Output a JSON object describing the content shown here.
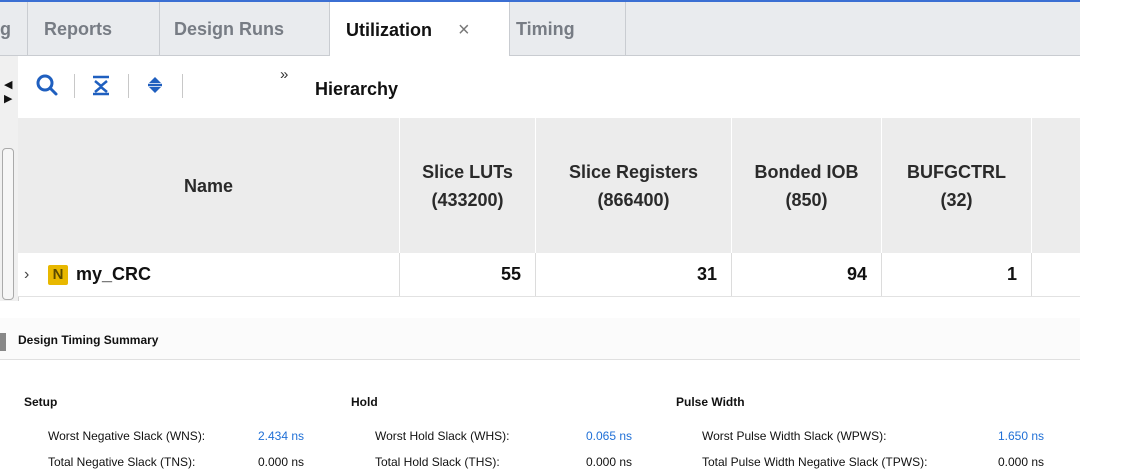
{
  "tabs": [
    {
      "label": "g"
    },
    {
      "label": "Reports"
    },
    {
      "label": "Design Runs"
    },
    {
      "label": "Utilization",
      "close": "×"
    },
    {
      "label": "Timing"
    }
  ],
  "toolbar": {
    "title": "Hierarchy",
    "chevron": "»",
    "icons": [
      "search-icon",
      "collapse-all-icon",
      "expand-all-icon"
    ]
  },
  "utilization_table": {
    "headers": [
      {
        "line1": "Name",
        "line2": ""
      },
      {
        "line1": "Slice LUTs",
        "line2": "(433200)"
      },
      {
        "line1": "Slice Registers",
        "line2": "(866400)"
      },
      {
        "line1": "Bonded IOB",
        "line2": "(850)"
      },
      {
        "line1": "BUFGCTRL",
        "line2": "(32)"
      }
    ],
    "rows": [
      {
        "expander": "›",
        "name": "my_CRC",
        "icon": "N",
        "values": [
          "55",
          "31",
          "94",
          "1"
        ]
      }
    ]
  },
  "timing": {
    "title": "Design Timing Summary",
    "setup": {
      "title": "Setup",
      "rows": [
        {
          "label": "Worst Negative Slack (WNS):",
          "value": "2.434 ns"
        },
        {
          "label": "Total Negative Slack (TNS):",
          "value": "0.000 ns"
        }
      ]
    },
    "hold": {
      "title": "Hold",
      "rows": [
        {
          "label": "Worst Hold Slack (WHS):",
          "value": "0.065 ns"
        },
        {
          "label": "Total Hold Slack (THS):",
          "value": "0.000 ns"
        }
      ]
    },
    "pulse": {
      "title": "Pulse Width",
      "rows": [
        {
          "label": "Worst Pulse Width Slack (WPWS):",
          "value": "1.650 ns"
        },
        {
          "label": "Total Pulse Width Negative Slack (TPWS):",
          "value": "0.000 ns"
        }
      ]
    },
    "colors": {
      "link": "#1f6fd6"
    }
  },
  "colors": {
    "accent": "#3b6fd3",
    "tab_bg": "#e9ebee",
    "header_bg": "#ececec",
    "icon_yellow": "#e8b800"
  }
}
